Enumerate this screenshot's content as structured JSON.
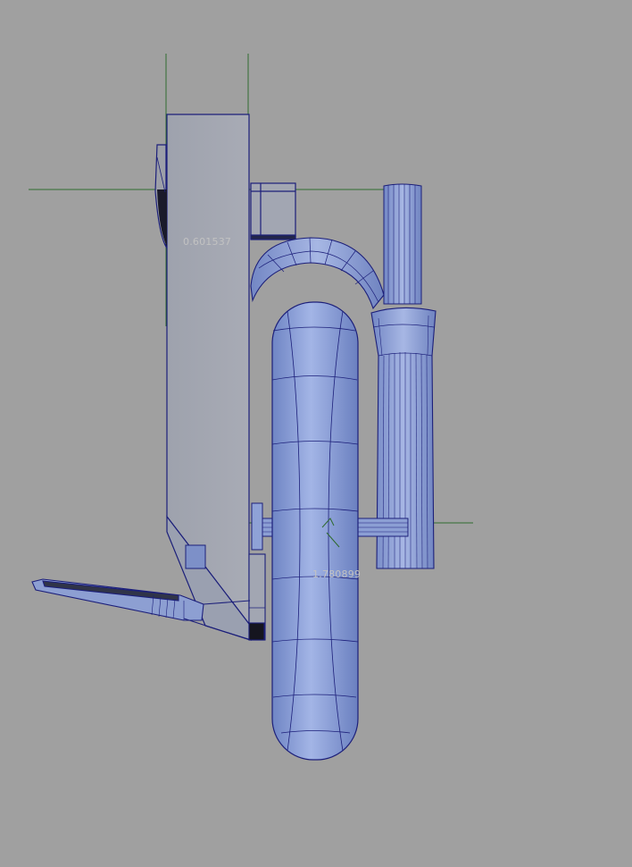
{
  "viewport": {
    "view": "side orthographic",
    "background_color": "#a0a0a0",
    "wire_color": "#1c1f7a",
    "surface_color": "#8ea3d8",
    "guide_color": "#2f6b2f"
  },
  "measurements": {
    "upper_value": "0.601537",
    "lower_value": "1.780899"
  }
}
